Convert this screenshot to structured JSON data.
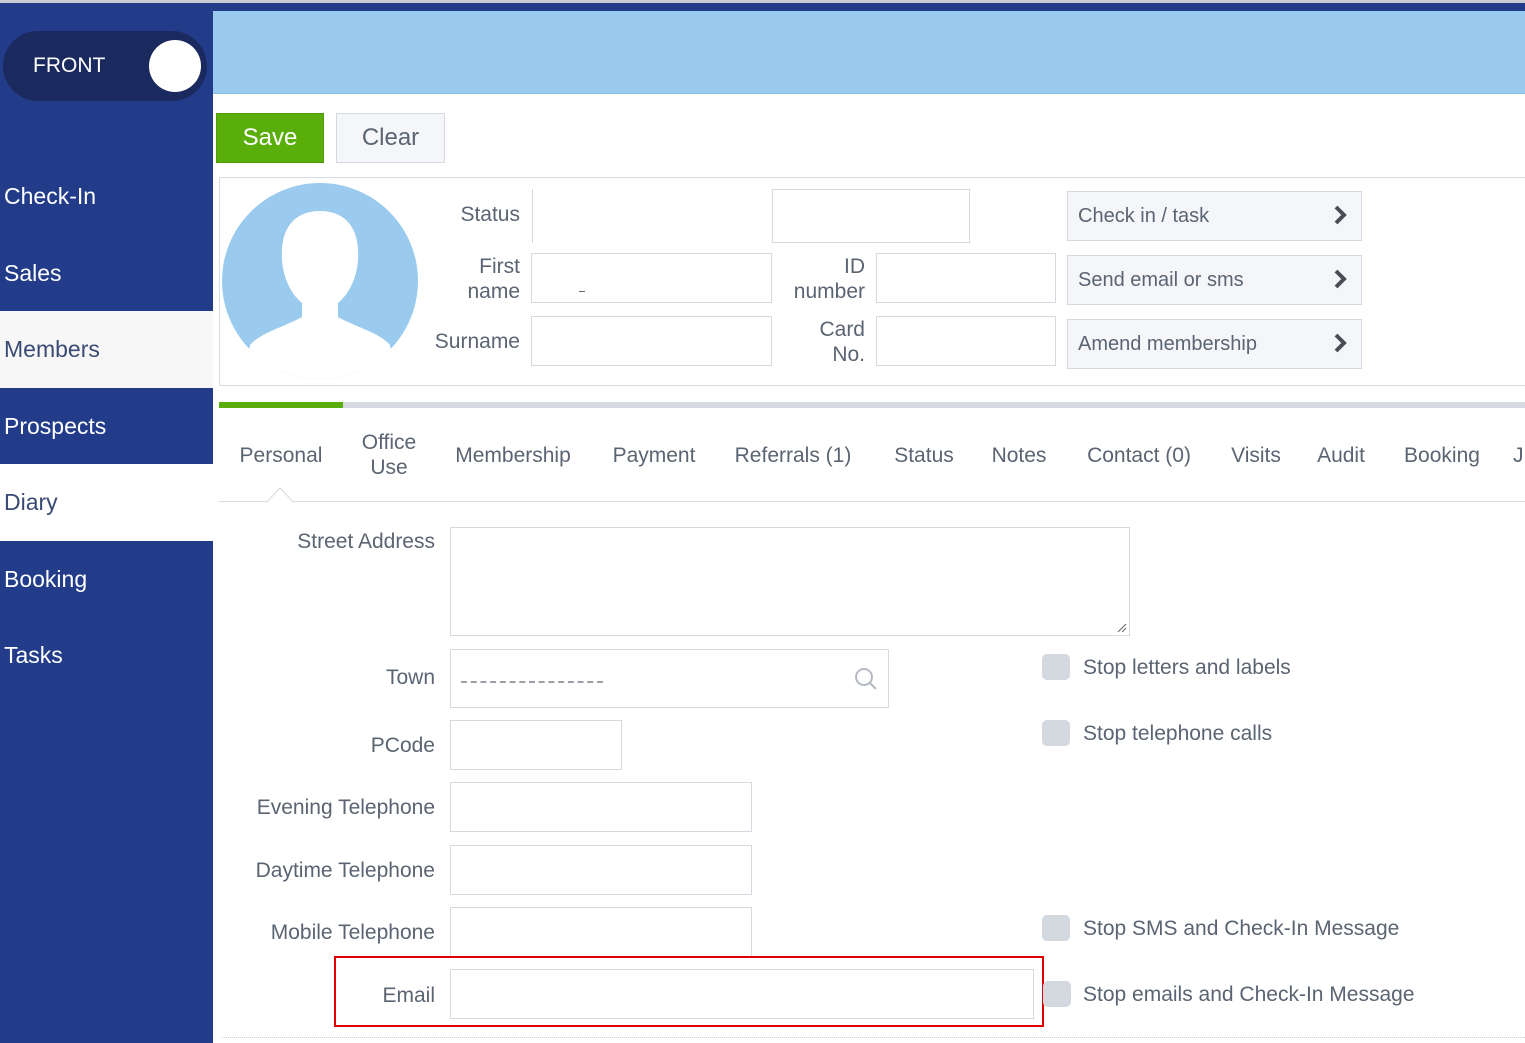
{
  "mode_toggle": {
    "label": "FRONT"
  },
  "sidebar": {
    "items": [
      {
        "label": "Check-In"
      },
      {
        "label": "Sales"
      },
      {
        "label": "Members",
        "active": true
      },
      {
        "label": "Prospects"
      },
      {
        "label": "Diary"
      },
      {
        "label": "Booking"
      },
      {
        "label": "Tasks"
      }
    ]
  },
  "toolbar": {
    "save_label": "Save",
    "clear_label": "Clear"
  },
  "member": {
    "status_label": "Status",
    "status_value": "",
    "first_name_label_1": "First",
    "first_name_label_2": "name",
    "first_name_value": "",
    "surname_label": "Surname",
    "surname_value": "",
    "id_label_1": "ID",
    "id_label_2": "number",
    "id_value": "",
    "card_label_1": "Card",
    "card_label_2": "No.",
    "card_value": ""
  },
  "actions": [
    {
      "label": "Check in / task",
      "icon": "chevron-right-icon"
    },
    {
      "label": "Send email or sms",
      "icon": "chevron-right-icon"
    },
    {
      "label": "Amend membership",
      "icon": "chevron-right-icon"
    }
  ],
  "progress": {
    "percent": 9.5
  },
  "tabs": [
    {
      "label": "Personal",
      "active": true
    },
    {
      "label": "Office Use"
    },
    {
      "label": "Membership"
    },
    {
      "label": "Payment"
    },
    {
      "label": "Referrals (1)"
    },
    {
      "label": "Status"
    },
    {
      "label": "Notes"
    },
    {
      "label": "Contact (0)"
    },
    {
      "label": "Visits"
    },
    {
      "label": "Audit"
    },
    {
      "label": "Booking"
    },
    {
      "label": "J"
    }
  ],
  "form": {
    "street_address_label": "Street Address",
    "street_address_value": "",
    "town_label": "Town",
    "pcode_label": "PCode",
    "pcode_value": "",
    "evening_tel_label": "Evening Telephone",
    "evening_tel_value": "",
    "daytime_tel_label": "Daytime Telephone",
    "daytime_tel_value": "",
    "mobile_tel_label": "Mobile Telephone",
    "mobile_tel_value": "",
    "email_label": "Email",
    "email_value": ""
  },
  "preferences": [
    {
      "label": "Stop letters and labels",
      "checked": false
    },
    {
      "label": "Stop telephone calls",
      "checked": false
    },
    {
      "label": "Stop SMS and Check-In Message",
      "checked": false
    },
    {
      "label": "Stop emails and Check-In Message",
      "checked": false
    }
  ],
  "colors": {
    "sidebar": "#223c8a",
    "header": "#9acbee",
    "accent_green": "#5aae0a",
    "highlight_red": "#e10000"
  }
}
